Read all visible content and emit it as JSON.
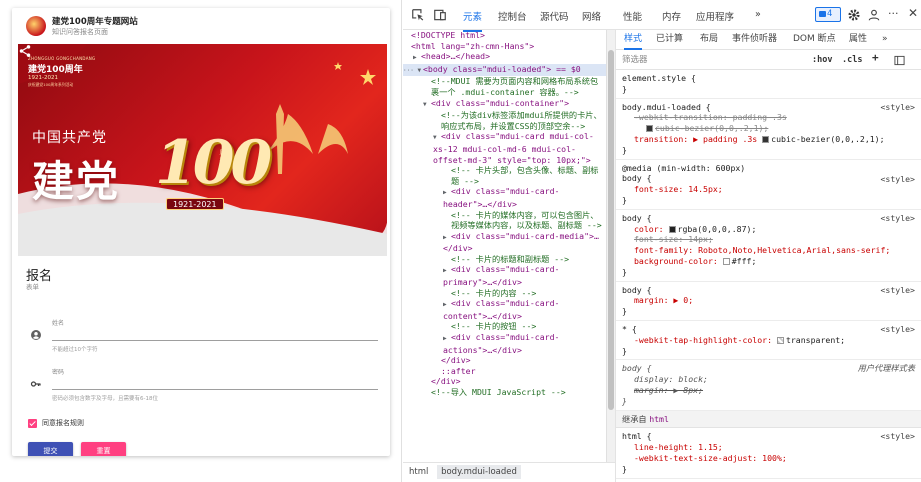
{
  "preview": {
    "card_title": "建党100周年专题网站",
    "card_subtitle": "知识问答报名页面",
    "banner": {
      "en": "ZHONGGUO GONGCHANDANG",
      "line1": "建党100周年",
      "line2": "1921-2021",
      "line3": "庆祝建党100周年系列活动",
      "party": "中国共产党",
      "big": "建党",
      "hundred": "100",
      "zhou": "周年",
      "years": "1921-2021"
    },
    "form_title": "报名",
    "form_subtitle": "表单",
    "name_label": "姓名",
    "name_help": "不能超过10个字符",
    "password_label": "密码",
    "password_help": "密码必须包含数字及字母，且需要有6-18位",
    "agree_label": "同意报名规则",
    "submit_label": "提交",
    "reset_label": "重置",
    "accent_primary": "#3f51b5",
    "accent_pink": "#ff4081"
  },
  "devtools": {
    "tabs": [
      "元素",
      "控制台",
      "源代码",
      "网络",
      "性能",
      "内存",
      "应用程序",
      "»"
    ],
    "issues_count": "4",
    "dom_lines": [
      "<!DOCTYPE html>",
      "<html lang=\"zh-cmn-Hans\">",
      "<head>…</head>",
      "<body class=\"mdui-loaded\"> == $0",
      "<!--MDUI 需要为页面内容和网格布局系统包裹一个 .mdui-container 容器。-->",
      "<div class=\"mdui-container\">",
      "<!--为该div标签添加mdui所提供的卡片、响应式布局，并设置CSS的顶部空余-->",
      "<div class=\"mdui-card mdui-col-xs-12 mdui-col-md-6 mdui-col-offset-md-3\" style=\"top: 10px;\">",
      "<!-- 卡片头部，包含头像、标题、副标题 -->",
      "<div class=\"mdui-card-header\">…</div>",
      "<!-- 卡片的媒体内容，可以包含图片、视频等媒体内容，以及标题、副标题 -->",
      "<div class=\"mdui-card-media\">…</div>",
      "<!-- 卡片的标题和副标题 -->",
      "<div class=\"mdui-card-primary\">…</div>",
      "<!-- 卡片的内容 -->",
      "<div class=\"mdui-card-content\">…</div>",
      "<!-- 卡片的按钮 -->",
      "<div class=\"mdui-card-actions\">…</div>",
      "</div>",
      "::after",
      "</div>",
      "<!--导入 MDUI JavaScript -->"
    ],
    "crumbs": [
      "html",
      "body.mdui-loaded"
    ],
    "styles_tabs": [
      "样式",
      "已计算",
      "布局",
      "事件侦听器",
      "DOM 断点",
      "属性",
      "»"
    ],
    "filter_placeholder": "筛选器",
    "hov": ":hov",
    "cls": ".cls",
    "rules": {
      "element_style": "element.style {",
      "r1_selector": "body.mdui-loaded {",
      "r1_src": "<style>",
      "r1_p1": "-webkit-transition: padding .3s",
      "r1_p1b": "cubic-bezier(0,0,.2,1);",
      "r1_p2": "transition: ▶ padding .3s ",
      "r1_p2b": "cubic-bezier(0,0,.2,1);",
      "media": "@media (min-width: 600px)",
      "r2_selector": "body {",
      "r2_src": "<style>",
      "r2_p1": "font-size: 14.5px;",
      "r3_selector": "body {",
      "r3_src": "<style>",
      "r3_p1": "color: ",
      "r3_p1b": "rgba(0,0,0,.87);",
      "r3_p2": "font-size: 14px;",
      "r3_p3": "font-family: Roboto,Noto,Helvetica,Arial,sans-serif;",
      "r3_p4": "background-color: ",
      "r3_p4b": "#fff;",
      "r4_selector": "body {",
      "r4_src": "<style>",
      "r4_p1": "margin: ▶ 0;",
      "r5_selector": "* {",
      "r5_src": "<style>",
      "r5_p1": "-webkit-tap-highlight-color: ",
      "r5_p1b": "transparent;",
      "r6_selector": "body {",
      "r6_src": "用户代理样式表",
      "r6_p1": "display: block;",
      "r6_p2": "margin: ▶ 8px;",
      "inherited_label": "继承自",
      "inherited_tag": "html",
      "r7_selector": "html {",
      "r7_src": "<style>",
      "r7_p1": "line-height: 1.15;",
      "r7_p2": "-webkit-text-size-adjust: 100%;",
      "close": "}"
    }
  }
}
